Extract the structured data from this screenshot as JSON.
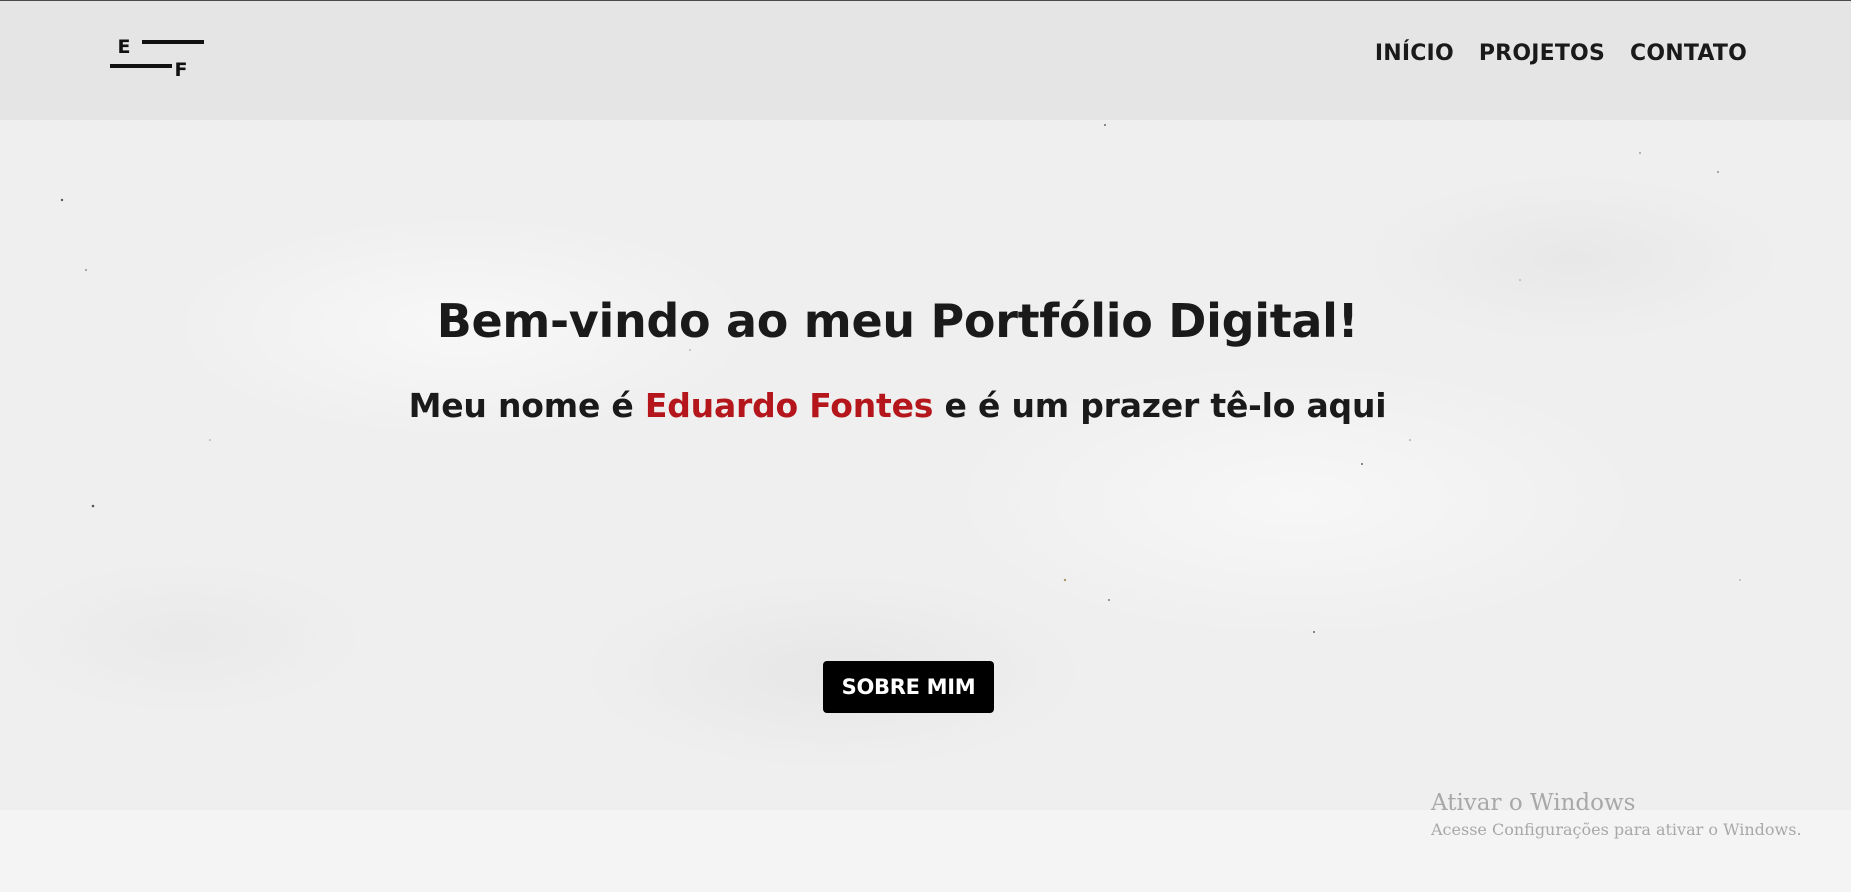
{
  "logo": {
    "letter_top": "E",
    "letter_bottom": "F"
  },
  "nav": {
    "items": [
      {
        "label": "INÍCIO"
      },
      {
        "label": "PROJETOS"
      },
      {
        "label": "CONTATO"
      }
    ]
  },
  "hero": {
    "title": "Bem-vindo ao meu Portfólio Digital!",
    "subtitle_prefix": "Meu nome é ",
    "subtitle_name": "Eduardo Fontes",
    "subtitle_suffix": " e é um prazer tê-lo aqui",
    "button_label": "SOBRE MIM"
  },
  "windows_watermark": {
    "title": "Ativar o Windows",
    "subtitle": "Acesse Configurações para ativar o Windows."
  },
  "colors": {
    "accent": "#b5161c",
    "navbar_bg": "#e5e5e5",
    "hero_bg": "#efefef",
    "button_bg": "#000000",
    "text": "#1a1a1a"
  }
}
